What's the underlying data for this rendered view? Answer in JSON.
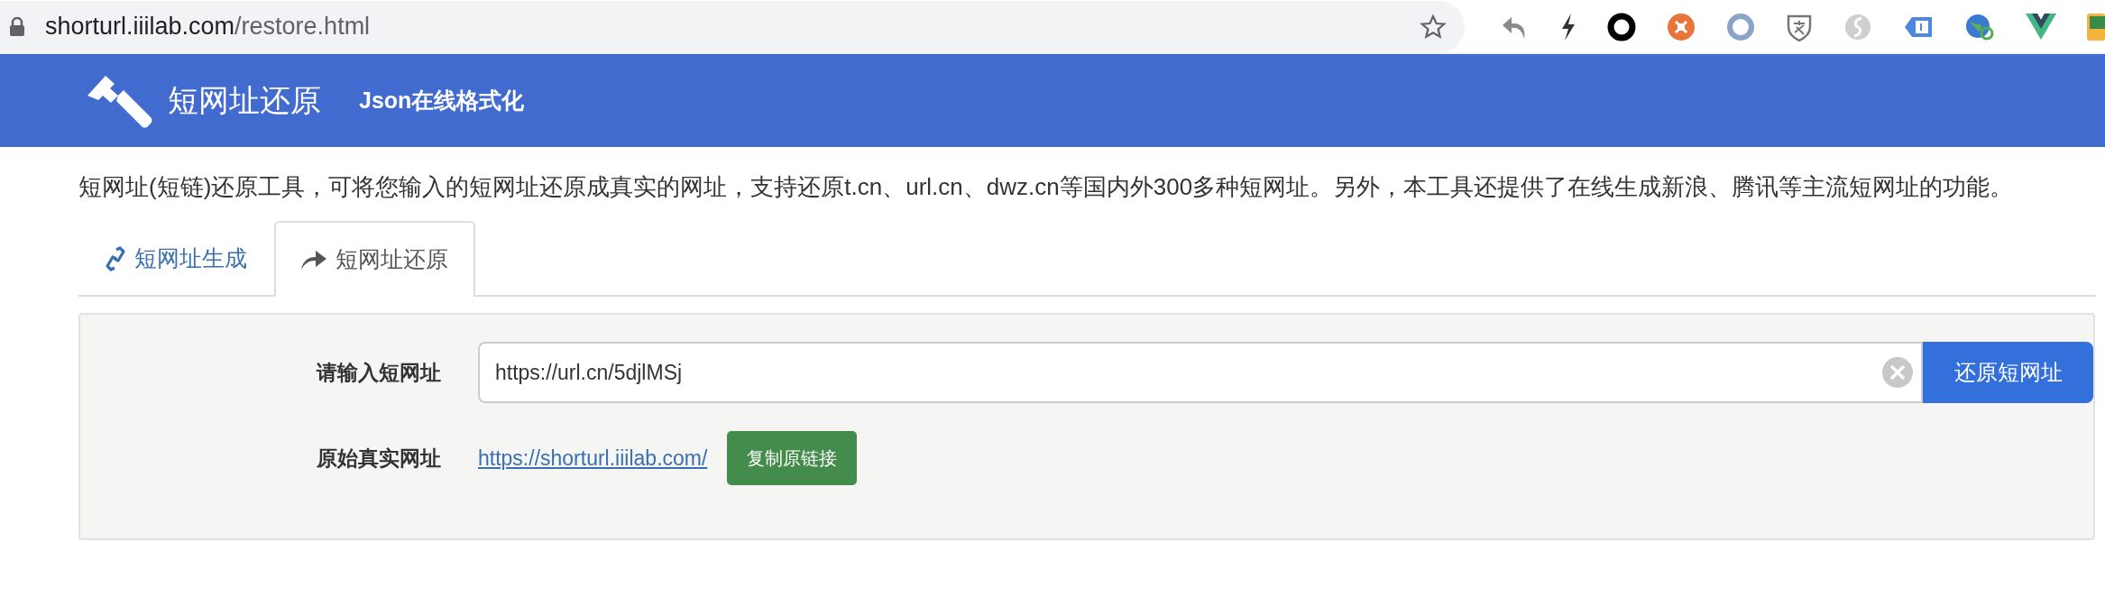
{
  "browser": {
    "address_host": "shorturl.iiilab.com",
    "address_path": "/restore.html"
  },
  "navbar": {
    "brand": "短网址还原",
    "links": [
      "Json在线格式化"
    ]
  },
  "description": "短网址(短链)还原工具，可将您输入的短网址还原成真实的网址，支持还原t.cn、url.cn、dwz.cn等国内外300多种短网址。另外，本工具还提供了在线生成新浪、腾讯等主流短网址的功能。",
  "tabs": [
    {
      "label": "短网址生成",
      "selected": false
    },
    {
      "label": "短网址还原",
      "selected": true
    }
  ],
  "form": {
    "input_label": "请输入短网址",
    "input_value": "https://url.cn/5djlMSj",
    "submit": "还原短网址",
    "result_label": "原始真实网址",
    "result_link": "https://shorturl.iiilab.com/",
    "copy": "复制原链接"
  }
}
